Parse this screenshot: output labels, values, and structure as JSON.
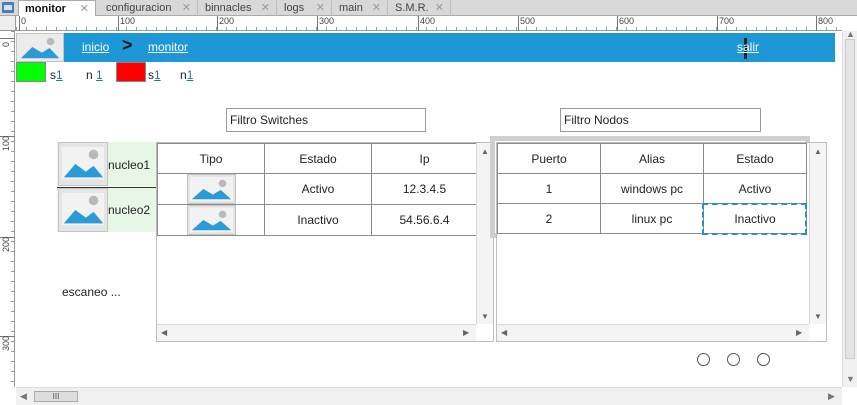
{
  "tabs": [
    {
      "label": "monitor",
      "active": true
    },
    {
      "label": "configuracion",
      "active": false
    },
    {
      "label": "binnacles",
      "active": false
    },
    {
      "label": "logs",
      "active": false
    },
    {
      "label": "main",
      "active": false
    },
    {
      "label": "S.M.R.",
      "active": false
    }
  ],
  "ruler": {
    "top_labels": [
      "0",
      "100",
      "200",
      "300",
      "400",
      "500",
      "600",
      "700",
      "800"
    ],
    "left_labels": [
      "0",
      "100",
      "200",
      "300"
    ]
  },
  "header": {
    "breadcrumb_home": "inicio",
    "breadcrumb_separator": ">",
    "breadcrumb_current": "monitor",
    "logout": "salir",
    "color": "#1e97d6"
  },
  "legend": {
    "green_prefix": "s",
    "green_count": "1",
    "green_n_prefix": "n",
    "green_n_count": "1",
    "red_prefix": "s",
    "red_count": "1",
    "red_n_prefix": "n",
    "red_n_count": "1",
    "green_color": "#00ff00",
    "red_color": "#ff0000"
  },
  "filters": {
    "switches": "Filtro Switches",
    "nodos": "Filtro Nodos"
  },
  "nodes": [
    {
      "label": "nucleo1"
    },
    {
      "label": "nucleo2"
    }
  ],
  "scan_status": "escaneo ...",
  "switches_table": {
    "headers": [
      "Tipo",
      "Estado",
      "Ip"
    ],
    "rows": [
      {
        "estado": "Activo",
        "ip": "12.3.4.5"
      },
      {
        "estado": "Inactivo",
        "ip": "54.56.6.4"
      }
    ]
  },
  "nodes_table": {
    "headers": [
      "Puerto",
      "Alias",
      "Estado"
    ],
    "rows": [
      {
        "puerto": "1",
        "alias": "windows pc",
        "estado": "Activo"
      },
      {
        "puerto": "2",
        "alias": "linux pc",
        "estado": "Inactivo"
      }
    ]
  },
  "hscroll_grip": "III"
}
